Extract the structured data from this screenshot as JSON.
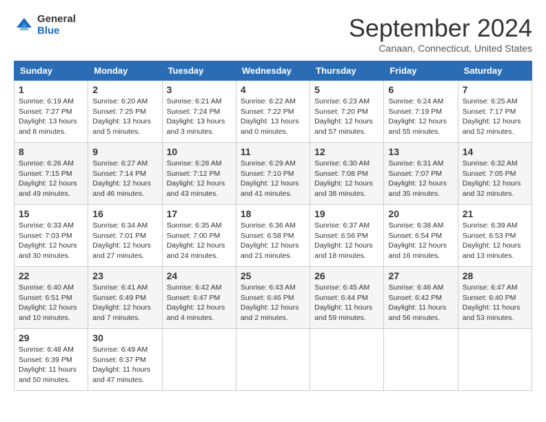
{
  "app": {
    "logo_general": "General",
    "logo_blue": "Blue"
  },
  "header": {
    "month": "September 2024",
    "location": "Canaan, Connecticut, United States"
  },
  "weekdays": [
    "Sunday",
    "Monday",
    "Tuesday",
    "Wednesday",
    "Thursday",
    "Friday",
    "Saturday"
  ],
  "weeks": [
    [
      {
        "day": 1,
        "sunrise": "6:19 AM",
        "sunset": "7:27 PM",
        "daylight": "13 hours and 8 minutes."
      },
      {
        "day": 2,
        "sunrise": "6:20 AM",
        "sunset": "7:25 PM",
        "daylight": "13 hours and 5 minutes."
      },
      {
        "day": 3,
        "sunrise": "6:21 AM",
        "sunset": "7:24 PM",
        "daylight": "13 hours and 3 minutes."
      },
      {
        "day": 4,
        "sunrise": "6:22 AM",
        "sunset": "7:22 PM",
        "daylight": "13 hours and 0 minutes."
      },
      {
        "day": 5,
        "sunrise": "6:23 AM",
        "sunset": "7:20 PM",
        "daylight": "12 hours and 57 minutes."
      },
      {
        "day": 6,
        "sunrise": "6:24 AM",
        "sunset": "7:19 PM",
        "daylight": "12 hours and 55 minutes."
      },
      {
        "day": 7,
        "sunrise": "6:25 AM",
        "sunset": "7:17 PM",
        "daylight": "12 hours and 52 minutes."
      }
    ],
    [
      {
        "day": 8,
        "sunrise": "6:26 AM",
        "sunset": "7:15 PM",
        "daylight": "12 hours and 49 minutes."
      },
      {
        "day": 9,
        "sunrise": "6:27 AM",
        "sunset": "7:14 PM",
        "daylight": "12 hours and 46 minutes."
      },
      {
        "day": 10,
        "sunrise": "6:28 AM",
        "sunset": "7:12 PM",
        "daylight": "12 hours and 43 minutes."
      },
      {
        "day": 11,
        "sunrise": "6:29 AM",
        "sunset": "7:10 PM",
        "daylight": "12 hours and 41 minutes."
      },
      {
        "day": 12,
        "sunrise": "6:30 AM",
        "sunset": "7:08 PM",
        "daylight": "12 hours and 38 minutes."
      },
      {
        "day": 13,
        "sunrise": "6:31 AM",
        "sunset": "7:07 PM",
        "daylight": "12 hours and 35 minutes."
      },
      {
        "day": 14,
        "sunrise": "6:32 AM",
        "sunset": "7:05 PM",
        "daylight": "12 hours and 32 minutes."
      }
    ],
    [
      {
        "day": 15,
        "sunrise": "6:33 AM",
        "sunset": "7:03 PM",
        "daylight": "12 hours and 30 minutes."
      },
      {
        "day": 16,
        "sunrise": "6:34 AM",
        "sunset": "7:01 PM",
        "daylight": "12 hours and 27 minutes."
      },
      {
        "day": 17,
        "sunrise": "6:35 AM",
        "sunset": "7:00 PM",
        "daylight": "12 hours and 24 minutes."
      },
      {
        "day": 18,
        "sunrise": "6:36 AM",
        "sunset": "6:58 PM",
        "daylight": "12 hours and 21 minutes."
      },
      {
        "day": 19,
        "sunrise": "6:37 AM",
        "sunset": "6:56 PM",
        "daylight": "12 hours and 18 minutes."
      },
      {
        "day": 20,
        "sunrise": "6:38 AM",
        "sunset": "6:54 PM",
        "daylight": "12 hours and 16 minutes."
      },
      {
        "day": 21,
        "sunrise": "6:39 AM",
        "sunset": "6:53 PM",
        "daylight": "12 hours and 13 minutes."
      }
    ],
    [
      {
        "day": 22,
        "sunrise": "6:40 AM",
        "sunset": "6:51 PM",
        "daylight": "12 hours and 10 minutes."
      },
      {
        "day": 23,
        "sunrise": "6:41 AM",
        "sunset": "6:49 PM",
        "daylight": "12 hours and 7 minutes."
      },
      {
        "day": 24,
        "sunrise": "6:42 AM",
        "sunset": "6:47 PM",
        "daylight": "12 hours and 4 minutes."
      },
      {
        "day": 25,
        "sunrise": "6:43 AM",
        "sunset": "6:46 PM",
        "daylight": "12 hours and 2 minutes."
      },
      {
        "day": 26,
        "sunrise": "6:45 AM",
        "sunset": "6:44 PM",
        "daylight": "11 hours and 59 minutes."
      },
      {
        "day": 27,
        "sunrise": "6:46 AM",
        "sunset": "6:42 PM",
        "daylight": "11 hours and 56 minutes."
      },
      {
        "day": 28,
        "sunrise": "6:47 AM",
        "sunset": "6:40 PM",
        "daylight": "11 hours and 53 minutes."
      }
    ],
    [
      {
        "day": 29,
        "sunrise": "6:48 AM",
        "sunset": "6:39 PM",
        "daylight": "11 hours and 50 minutes."
      },
      {
        "day": 30,
        "sunrise": "6:49 AM",
        "sunset": "6:37 PM",
        "daylight": "11 hours and 47 minutes."
      },
      null,
      null,
      null,
      null,
      null
    ]
  ]
}
